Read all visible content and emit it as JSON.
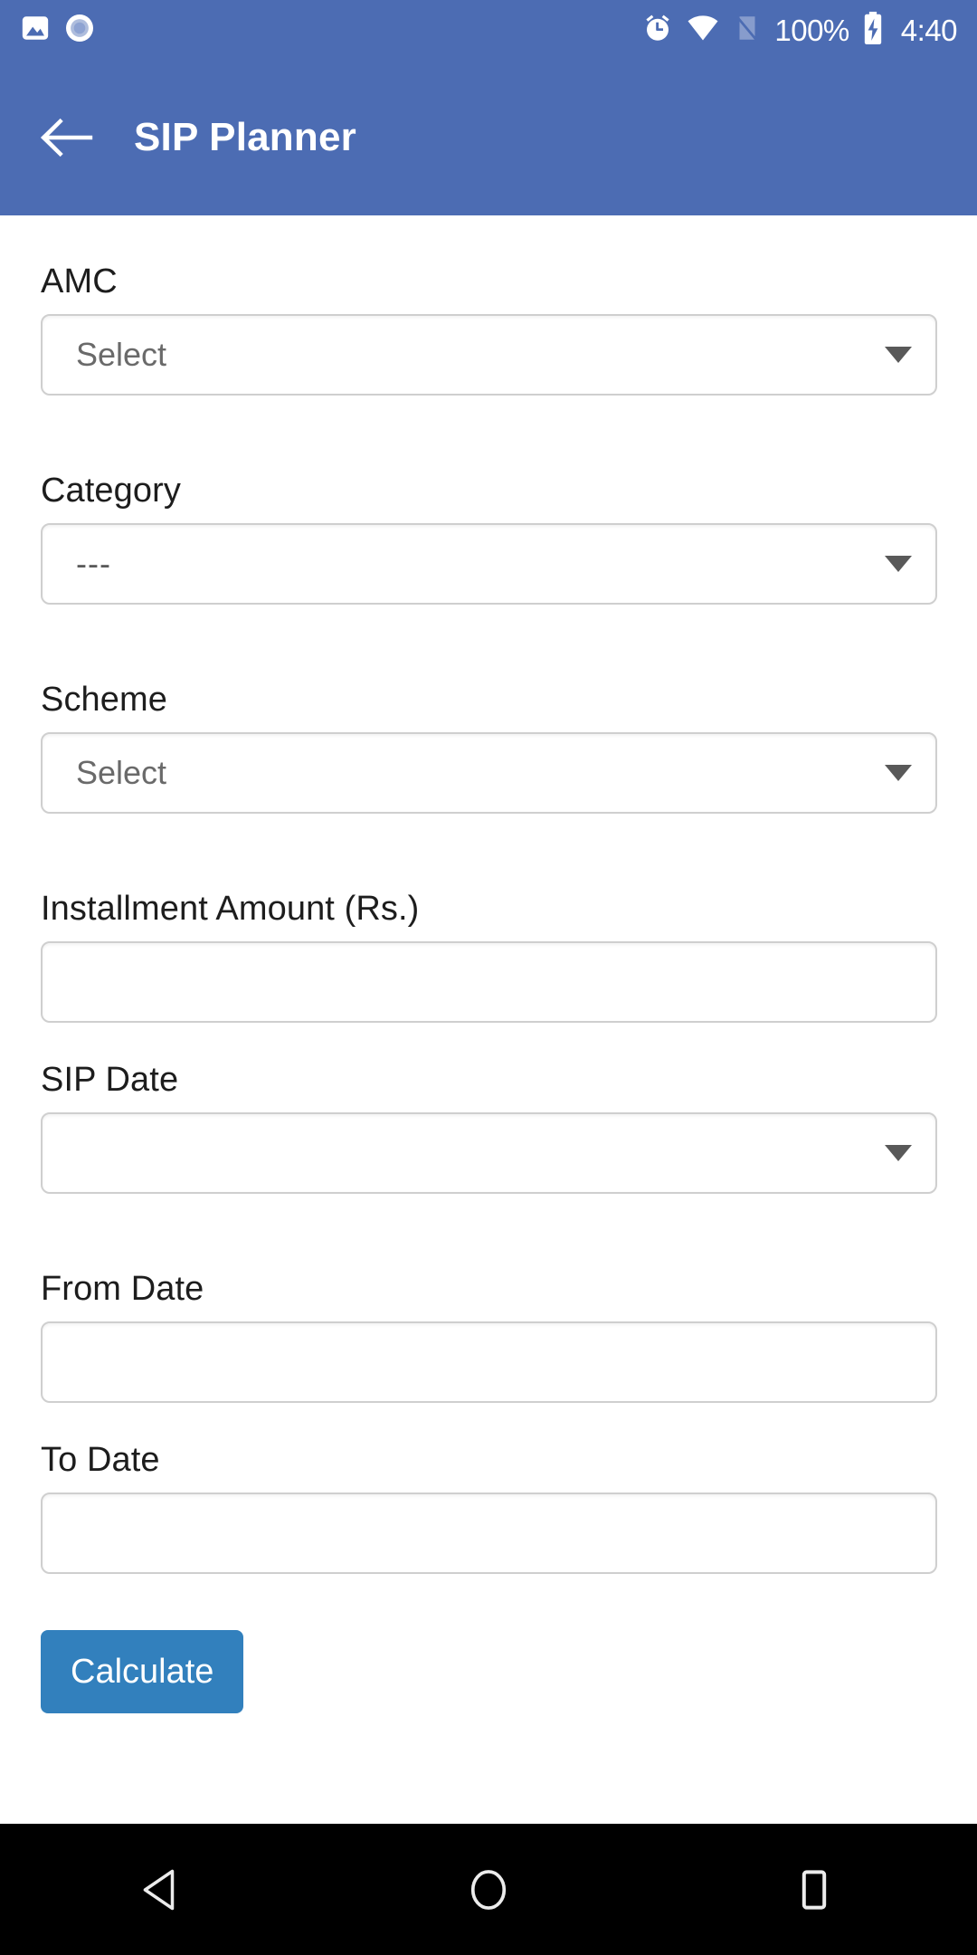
{
  "status_bar": {
    "left_icons": [
      {
        "name": "image-icon"
      },
      {
        "name": "screen-record-icon"
      }
    ],
    "right_icons": [
      {
        "name": "alarm-icon"
      },
      {
        "name": "wifi-icon"
      },
      {
        "name": "no-sim-signal-icon"
      }
    ],
    "battery_percent": "100%",
    "battery_icon": "battery-charging-icon",
    "time": "4:40"
  },
  "app_bar": {
    "back_icon": "back-arrow-icon",
    "title": "SIP Planner",
    "background_color": "#4c6cb3"
  },
  "form": {
    "fields": [
      {
        "label": "AMC",
        "type": "select",
        "value": "Select"
      },
      {
        "label": "Category",
        "type": "select",
        "value": "---"
      },
      {
        "label": "Scheme",
        "type": "select",
        "value": "Select"
      },
      {
        "label": "Installment Amount (Rs.)",
        "type": "text",
        "value": ""
      },
      {
        "label": "SIP Date",
        "type": "select",
        "value": ""
      },
      {
        "label": "From Date",
        "type": "text",
        "value": ""
      },
      {
        "label": "To Date",
        "type": "text",
        "value": ""
      }
    ],
    "submit_label": "Calculate",
    "submit_color": "#3280bd"
  },
  "nav_bar": {
    "back_label": "back-triangle-icon",
    "home_label": "home-circle-icon",
    "recents_label": "recents-square-icon"
  }
}
